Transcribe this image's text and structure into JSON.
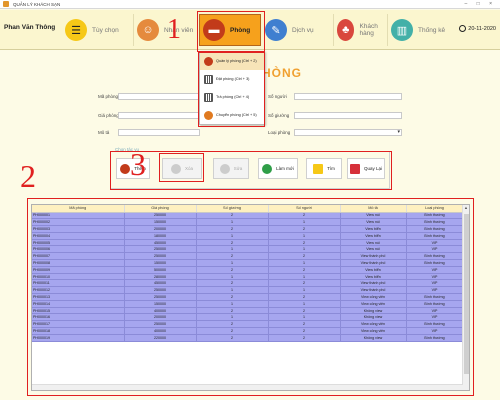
{
  "window": {
    "title": "QUẢN LÝ KHÁCH SẠN",
    "controls": "– □ ×"
  },
  "user": {
    "name": "Phan Văn Thông"
  },
  "nav": [
    {
      "label": "Tùy chọn",
      "icon": "list-icon",
      "color": "#f6c817"
    },
    {
      "label": "Nhân viên",
      "icon": "people-icon",
      "color": "#e58a3d"
    },
    {
      "label": "Phòng",
      "icon": "bed-icon",
      "color": "#c23b1a"
    },
    {
      "label": "Dịch vụ",
      "icon": "service-icon",
      "color": "#3f7fd0"
    },
    {
      "label": "Khách hàng",
      "icon": "customer-icon",
      "color": "#d9473d"
    },
    {
      "label": "Thống kê",
      "icon": "chart-icon",
      "color": "#43b0a8"
    }
  ],
  "date": "20-11-2020",
  "dropdown": [
    {
      "label": "Quản lý phòng (Ctrl + 2)"
    },
    {
      "label": "Đặt phòng (Ctrl + 3)"
    },
    {
      "label": "Trả phòng (Ctrl + 4)"
    },
    {
      "label": "Chuyển phòng (Ctrl + 5)"
    }
  ],
  "form": {
    "heading": "HÒNG",
    "ma_phong": "Mã phòng",
    "gia_phong": "Giá phòng",
    "mo_ta": "Mô tả",
    "so_nguoi": "Số người",
    "so_giuong": "Số giường",
    "loai_phong": "Loại phòng"
  },
  "actions": {
    "group_title": "Chọn tác vụ",
    "them": "Thêm",
    "xoa": "Xóa",
    "sua": "Sửa",
    "lam_moi": "Làm mới",
    "tim": "Tìm",
    "quay_lai": "Quay Lại"
  },
  "annotations": [
    "1",
    "2",
    "3"
  ],
  "table": {
    "columns": [
      "Mã phòng",
      "Giá phòng",
      "Số giường",
      "Số người",
      "Mô tả",
      "Loại phòng"
    ],
    "rows": [
      [
        "PH000001",
        "250000",
        "2",
        "2",
        "View núi",
        "Bình thường"
      ],
      [
        "PH000002",
        "150000",
        "1",
        "1",
        "View núi",
        "Bình thường"
      ],
      [
        "PH000003",
        "200000",
        "2",
        "2",
        "View biển",
        "Bình thường"
      ],
      [
        "PH000004",
        "180000",
        "1",
        "1",
        "View biển",
        "Bình thường"
      ],
      [
        "PH000005",
        "450000",
        "2",
        "2",
        "View núi",
        "VIP"
      ],
      [
        "PH000006",
        "250000",
        "1",
        "1",
        "View núi",
        "VIP"
      ],
      [
        "PH000007",
        "250000",
        "2",
        "2",
        "View thành phố",
        "Bình thường"
      ],
      [
        "PH000008",
        "150000",
        "1",
        "1",
        "View thành phố",
        "Bình thường"
      ],
      [
        "PH000009",
        "500000",
        "2",
        "2",
        "View biển",
        "VIP"
      ],
      [
        "PH000010",
        "280000",
        "1",
        "1",
        "View biển",
        "VIP"
      ],
      [
        "PH000011",
        "450000",
        "2",
        "2",
        "View thành phố",
        "VIP"
      ],
      [
        "PH000012",
        "250000",
        "1",
        "1",
        "View thành phố",
        "VIP"
      ],
      [
        "PH000013",
        "250000",
        "2",
        "2",
        "View công viên",
        "Bình thường"
      ],
      [
        "PH000014",
        "150000",
        "1",
        "1",
        "View công viên",
        "Bình thường"
      ],
      [
        "PH000015",
        "400000",
        "2",
        "2",
        "Không view",
        "VIP"
      ],
      [
        "PH000016",
        "200000",
        "1",
        "1",
        "Không view",
        "VIP"
      ],
      [
        "PH000017",
        "250000",
        "2",
        "2",
        "View công viên",
        "Bình thường"
      ],
      [
        "PH000018",
        "400000",
        "2",
        "2",
        "View công viên",
        "VIP"
      ],
      [
        "PH000019",
        "220000",
        "2",
        "2",
        "Không view",
        "Bình thường"
      ]
    ]
  }
}
